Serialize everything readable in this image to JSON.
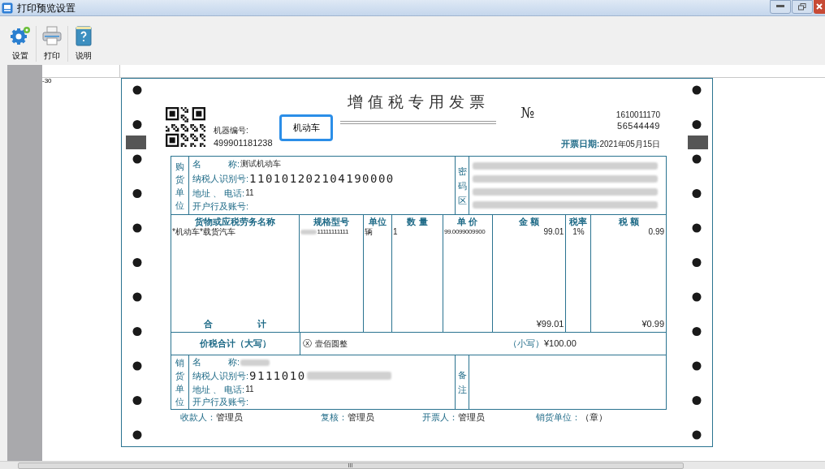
{
  "window": {
    "title": "打印预览设置"
  },
  "toolbar": [
    {
      "kind": "settings",
      "label": "设置"
    },
    {
      "kind": "print",
      "label": "打印"
    },
    {
      "kind": "help",
      "label": "说明"
    }
  ],
  "ruler": {
    "label": "-30"
  },
  "invoice": {
    "title": "增值税专用发票",
    "machine_label": "机器编号:",
    "machine_no": "499901181238",
    "type_badge": "机动车",
    "no_mark": "№",
    "code": "1610011170",
    "number": "56544449",
    "date_label": "开票日期:",
    "date": "2021年05月15日",
    "buyer": {
      "section": "购货单位",
      "cipher_label": "密码区",
      "fields": [
        {
          "label": "名　　　称:",
          "value": "测试机动车",
          "kind": "small"
        },
        {
          "label": "纳税人识别号:",
          "value": "110101202104190000",
          "kind": "large"
        },
        {
          "label": "地址 、 电话:",
          "value": "11",
          "kind": "small"
        },
        {
          "label": "开户行及账号:",
          "kind": "small"
        }
      ]
    },
    "goods": {
      "columns": [
        "货物或应税劳务名称",
        "规格型号",
        "单位",
        "数 量",
        "单 价",
        "金 额",
        "税率",
        "税 额"
      ],
      "rows": [
        {
          "cells": [
            "*机动车*载货汽车",
            "11111111111",
            "辆",
            "1",
            "99.0099009900",
            "99.01",
            "1%",
            "0.99"
          ]
        }
      ],
      "total_label": "合　　　　　计",
      "total_amount": "¥99.01",
      "total_tax": "¥0.99"
    },
    "grand_total": {
      "label": "价税合计（大写）",
      "mark": "ⓧ",
      "upper": "壹佰圆整",
      "lower_label": "（小写）",
      "lower": "¥100.00"
    },
    "seller": {
      "section": "销货单位",
      "remark_label": "备注",
      "fields": [
        {
          "label": "名　　　称:",
          "kind": "small"
        },
        {
          "label": "纳税人识别号:",
          "value": "9111010",
          "kind": "large"
        },
        {
          "label": "地址 、 电话:",
          "value": "11",
          "kind": "small"
        },
        {
          "label": "开户行及账号:",
          "kind": "small"
        }
      ]
    },
    "signatures": [
      {
        "label": "收款人：",
        "value": "管理员"
      },
      {
        "label": "复核：",
        "value": "管理员"
      },
      {
        "label": "开票人：",
        "value": "管理员"
      },
      {
        "label": "销货单位：",
        "value": "（章）"
      }
    ]
  }
}
